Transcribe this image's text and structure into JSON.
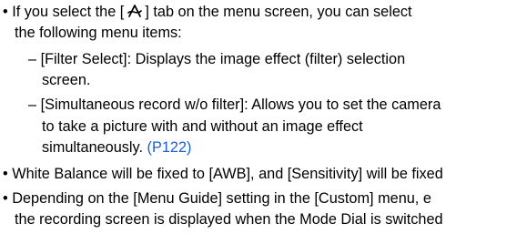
{
  "bullets": [
    {
      "lines": [
        {
          "pre": "• If you select the [",
          "icon": "filter-tab-icon",
          "post": "] tab on the menu screen, you can select"
        },
        "the following menu items:"
      ],
      "subitems": [
        {
          "lines": [
            "– [Filter Select]: Displays the image effect (filter) selection",
            "screen."
          ]
        },
        {
          "lines": [
            "– [Simultaneous record w/o filter]: Allows you to set the camera",
            "to take a picture with and without an image effect",
            "simultaneously."
          ],
          "link": "(P122)"
        }
      ]
    },
    {
      "lines": [
        "• White Balance will be fixed to [AWB], and [Sensitivity] will be fixed"
      ]
    },
    {
      "lines": [
        "• Depending on the [Menu Guide] setting in the [Custom] menu, e",
        "the recording screen is displayed when the Mode Dial is switched"
      ]
    }
  ],
  "colors": {
    "text": "#000000",
    "link": "#1a5fd6"
  }
}
